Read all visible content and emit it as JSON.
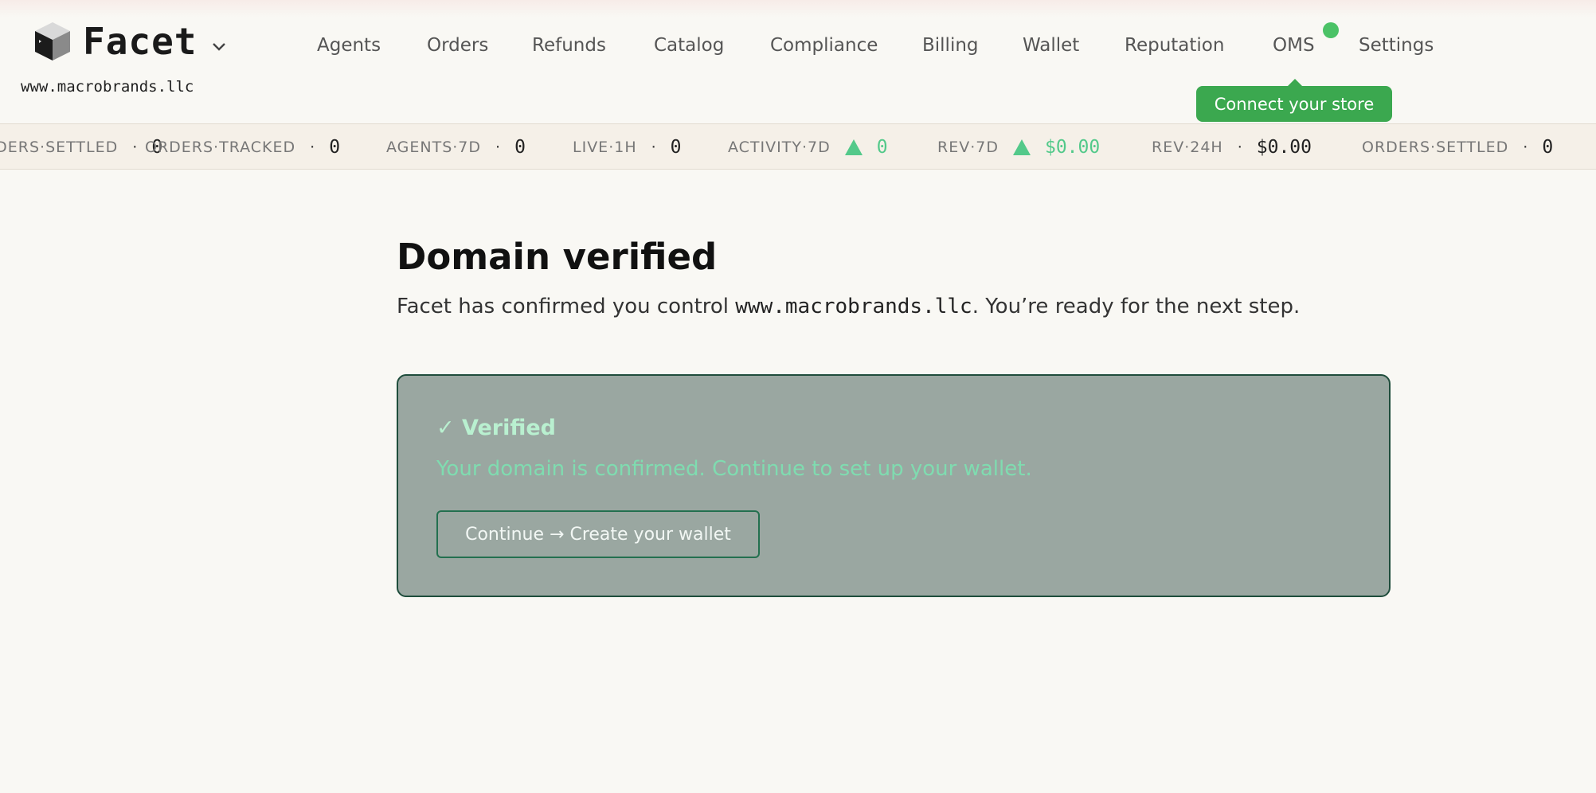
{
  "app": {
    "brand": "Facet",
    "domain": "www.macrobrands.llc"
  },
  "nav": {
    "items": [
      {
        "label": "Agents"
      },
      {
        "label": "Orders"
      },
      {
        "label": "Refunds"
      },
      {
        "label": "Catalog"
      },
      {
        "label": "Compliance"
      },
      {
        "label": "Billing"
      },
      {
        "label": "Wallet"
      },
      {
        "label": "Reputation"
      },
      {
        "label": "OMS"
      },
      {
        "label": "Settings"
      }
    ],
    "oms_tooltip": "Connect your store"
  },
  "ticker": {
    "items": [
      {
        "label": "ORDERS·SETTLED",
        "value": "0",
        "trend": "none"
      },
      {
        "label": "ORDERS·TRACKED",
        "value": "0",
        "trend": "none"
      },
      {
        "label": "AGENTS·7D",
        "value": "0",
        "trend": "none"
      },
      {
        "label": "LIVE·1H",
        "value": "0",
        "trend": "none"
      },
      {
        "label": "ACTIVITY·7D",
        "value": "0",
        "trend": "up"
      },
      {
        "label": "REV·7D",
        "value": "$0.00",
        "trend": "up"
      },
      {
        "label": "REV·24H",
        "value": "$0.00",
        "trend": "none"
      },
      {
        "label": "ORDERS·SETTLED",
        "value": "0",
        "trend": "none"
      }
    ],
    "separator": "·"
  },
  "main": {
    "title": "Domain verified",
    "subtitle_pre": "Facet has confirmed you control ",
    "subtitle_domain": "www.macrobrands.llc",
    "subtitle_post": ". You’re ready for the next step.",
    "card": {
      "title": "✓ Verified",
      "description": "Your domain is confirmed. Continue to set up your wallet.",
      "button_label": "Continue → Create your wallet"
    }
  },
  "colors": {
    "accent_green": "#3ba84f",
    "status_dot": "#4bc266",
    "up_trend": "#53c98a",
    "card_bg": "#9aa7a1",
    "card_border": "#1f4d3c"
  }
}
